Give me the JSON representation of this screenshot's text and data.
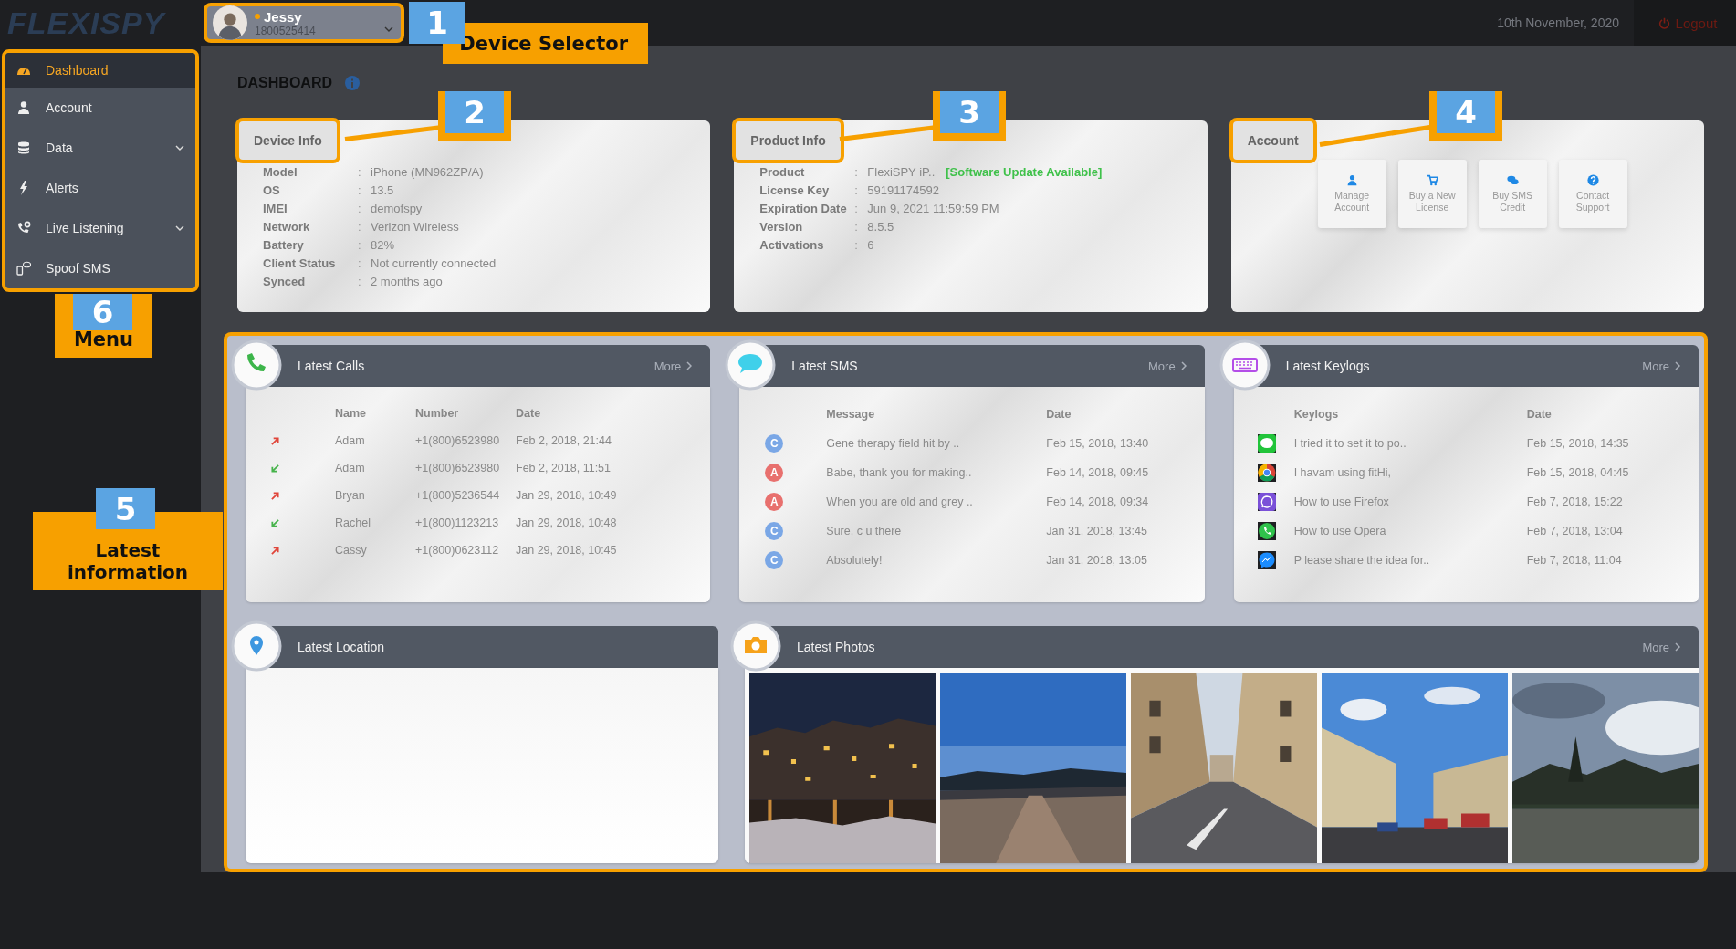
{
  "logo": "FLEXISPY",
  "device_selector": {
    "name": "Jessy",
    "number": "1800525414",
    "online": true
  },
  "header": {
    "date": "10th November, 2020",
    "logout": "Logout"
  },
  "menu": [
    {
      "label": "Dashboard",
      "selected": true,
      "expandable": false
    },
    {
      "label": "Account",
      "selected": false,
      "expandable": false
    },
    {
      "label": "Data",
      "selected": false,
      "expandable": true
    },
    {
      "label": "Alerts",
      "selected": false,
      "expandable": false
    },
    {
      "label": "Live Listening",
      "selected": false,
      "expandable": true
    },
    {
      "label": "Spoof SMS",
      "selected": false,
      "expandable": false
    }
  ],
  "page_title": "DASHBOARD",
  "device_info": {
    "title": "Device Info",
    "rows": [
      {
        "label": "Model",
        "separator": ":",
        "value": "iPhone (MN962ZP/A)"
      },
      {
        "label": "OS",
        "separator": ":",
        "value": "13.5"
      },
      {
        "label": "IMEI",
        "separator": ":",
        "value": "demofspy"
      },
      {
        "label": "Network",
        "separator": ":",
        "value": "Verizon Wireless"
      },
      {
        "label": "Battery",
        "separator": ":",
        "value": "82%"
      },
      {
        "label": "Client Status",
        "separator": ":",
        "value": "Not currently connected"
      },
      {
        "label": "Synced",
        "separator": ":",
        "value": "2 months ago"
      }
    ]
  },
  "product_info": {
    "title": "Product Info",
    "rows": [
      {
        "label": "Product",
        "separator": ":",
        "value": "FlexiSPY iP..",
        "badge": "[Software Update Available]"
      },
      {
        "label": "License Key",
        "separator": ":",
        "value": "59191174592"
      },
      {
        "label": "Expiration Date",
        "separator": ":",
        "value": "Jun 9, 2021 11:59:59 PM"
      },
      {
        "label": "Version",
        "separator": ":",
        "value": "8.5.5"
      },
      {
        "label": "Activations",
        "separator": ":",
        "value": "6"
      }
    ]
  },
  "account": {
    "title": "Account",
    "actions": [
      {
        "label": "Manage Account"
      },
      {
        "label": "Buy a New License"
      },
      {
        "label": "Buy SMS Credit"
      },
      {
        "label": "Contact Support"
      }
    ]
  },
  "latest_calls": {
    "title": "Latest Calls",
    "more": "More",
    "columns": [
      "Name",
      "Number",
      "Date"
    ],
    "rows": [
      {
        "kind": "outgoing",
        "name": "Adam",
        "number": "+1(800)6523980",
        "date": "Feb 2, 2018, 21:44"
      },
      {
        "kind": "incoming",
        "name": "Adam",
        "number": "+1(800)6523980",
        "date": "Feb 2, 2018, 11:51"
      },
      {
        "kind": "outgoing",
        "name": "Bryan",
        "number": "+1(800)5236544",
        "date": "Jan 29, 2018, 10:49"
      },
      {
        "kind": "incoming",
        "name": "Rachel",
        "number": "+1(800)1123213",
        "date": "Jan 29, 2018, 10:48"
      },
      {
        "kind": "outgoing",
        "name": "Cassy",
        "number": "+1(800)0623112",
        "date": "Jan 29, 2018, 10:45"
      }
    ]
  },
  "latest_sms": {
    "title": "Latest SMS",
    "more": "More",
    "columns": [
      "Message",
      "Date"
    ],
    "rows": [
      {
        "letter": "C",
        "color": "#7aa7e6",
        "message": "Gene therapy field hit by ..",
        "date": "Feb 15, 2018, 13:40"
      },
      {
        "letter": "A",
        "color": "#e8706e",
        "message": "Babe, thank you for making..",
        "date": "Feb 14, 2018, 09:45"
      },
      {
        "letter": "A",
        "color": "#e8706e",
        "message": "When you are old and grey ..",
        "date": "Feb 14, 2018, 09:34"
      },
      {
        "letter": "C",
        "color": "#7aa7e6",
        "message": "Sure, c u there",
        "date": "Jan 31, 2018, 13:45"
      },
      {
        "letter": "C",
        "color": "#7aa7e6",
        "message": "Absolutely!",
        "date": "Jan 31, 2018, 13:05"
      }
    ]
  },
  "latest_keylogs": {
    "title": "Latest Keylogs",
    "more": "More",
    "columns": [
      "Keylogs",
      "Date"
    ],
    "rows": [
      {
        "kind": "line",
        "text": "I tried it to set it to po..",
        "date": "Feb 15, 2018, 14:35"
      },
      {
        "kind": "chrome",
        "text": "I havam using fitHi,",
        "date": "Feb 15, 2018, 04:45"
      },
      {
        "kind": "viber",
        "text": "How to use Firefox",
        "date": "Feb 7, 2018, 15:22"
      },
      {
        "kind": "whatsapp",
        "text": "How to use Opera",
        "date": "Feb 7, 2018, 13:04"
      },
      {
        "kind": "messenger",
        "text": "P lease share the idea for..",
        "date": "Feb 7, 2018, 11:04"
      }
    ]
  },
  "latest_location": {
    "title": "Latest Location"
  },
  "latest_photos": {
    "title": "Latest Photos",
    "more": "More"
  },
  "annotations": [
    {
      "number": "1",
      "label": "Device Selector"
    },
    {
      "number": "2"
    },
    {
      "number": "3"
    },
    {
      "number": "4"
    },
    {
      "number": "6",
      "label": "Menu"
    },
    {
      "number": "5",
      "label": "Latest information"
    }
  ]
}
